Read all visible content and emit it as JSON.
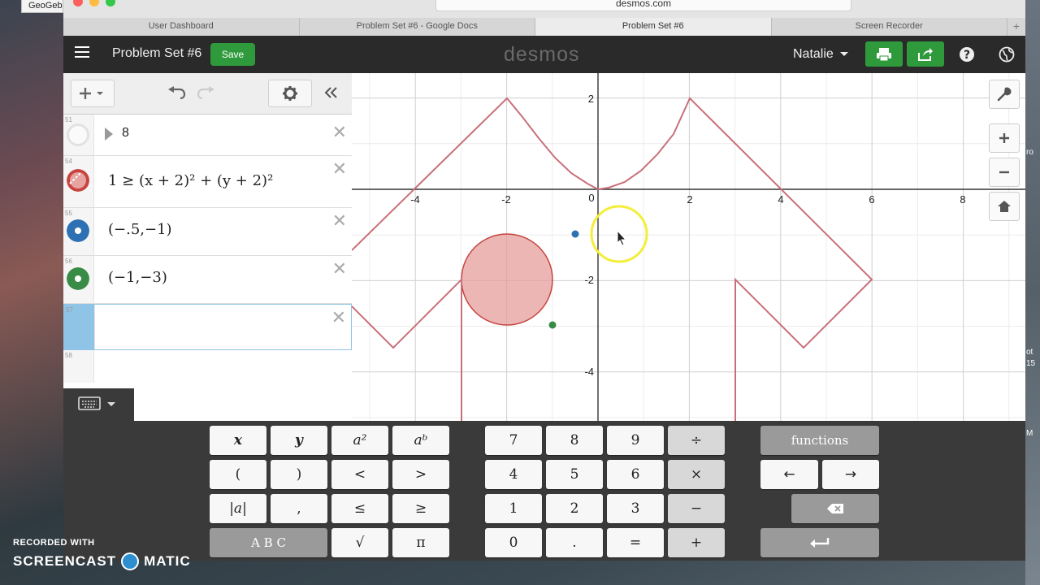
{
  "desktop": {
    "edge_labels": [
      "ot",
      "15",
      "M",
      "ro"
    ]
  },
  "browser": {
    "side_tab": "GeoGeb",
    "address": "desmos.com",
    "tabs": [
      {
        "label": "User Dashboard",
        "active": false
      },
      {
        "label": "Problem Set #6 - Google Docs",
        "active": false
      },
      {
        "label": "Problem Set #6",
        "active": true
      },
      {
        "label": "Screen Recorder",
        "active": false
      }
    ],
    "new_tab": "+"
  },
  "header": {
    "title": "Problem Set #6",
    "save_label": "Save",
    "logo": "desmos",
    "user": "Natalie"
  },
  "expressions": [
    {
      "num": "51",
      "text": "8",
      "kind": "folder",
      "color": "#cccccc"
    },
    {
      "num": "54",
      "text": "1 ≥ (x + 2)² + (y + 2)²",
      "kind": "inequality",
      "color": "#c74440"
    },
    {
      "num": "55",
      "text": "(−.5,−1)",
      "kind": "point",
      "color": "#2d70b3"
    },
    {
      "num": "56",
      "text": "(−1,−3)",
      "kind": "point",
      "color": "#388c46"
    },
    {
      "num": "57",
      "text": "",
      "kind": "empty",
      "color": ""
    },
    {
      "num": "58",
      "text": "",
      "kind": "blank",
      "color": ""
    }
  ],
  "graph": {
    "x_ticks": [
      "-4",
      "-2",
      "0",
      "2",
      "4",
      "6",
      "8"
    ],
    "y_ticks": [
      "2",
      "-2",
      "-4"
    ]
  },
  "keypad": {
    "left": [
      "x",
      "y",
      "a²",
      "aᵇ",
      "(",
      ")",
      "<",
      ">",
      "|a|",
      ",",
      "≤",
      "≥",
      "A B C",
      "√",
      "π"
    ],
    "numbers": [
      "7",
      "8",
      "9",
      "÷",
      "4",
      "5",
      "6",
      "×",
      "1",
      "2",
      "3",
      "−",
      "0",
      ".",
      "=",
      "+"
    ],
    "functions_label": "functions",
    "arrows": [
      "←",
      "→"
    ]
  },
  "watermark": {
    "line1": "RECORDED WITH",
    "brand_a": "SCREENCAST",
    "brand_b": "MATIC"
  }
}
